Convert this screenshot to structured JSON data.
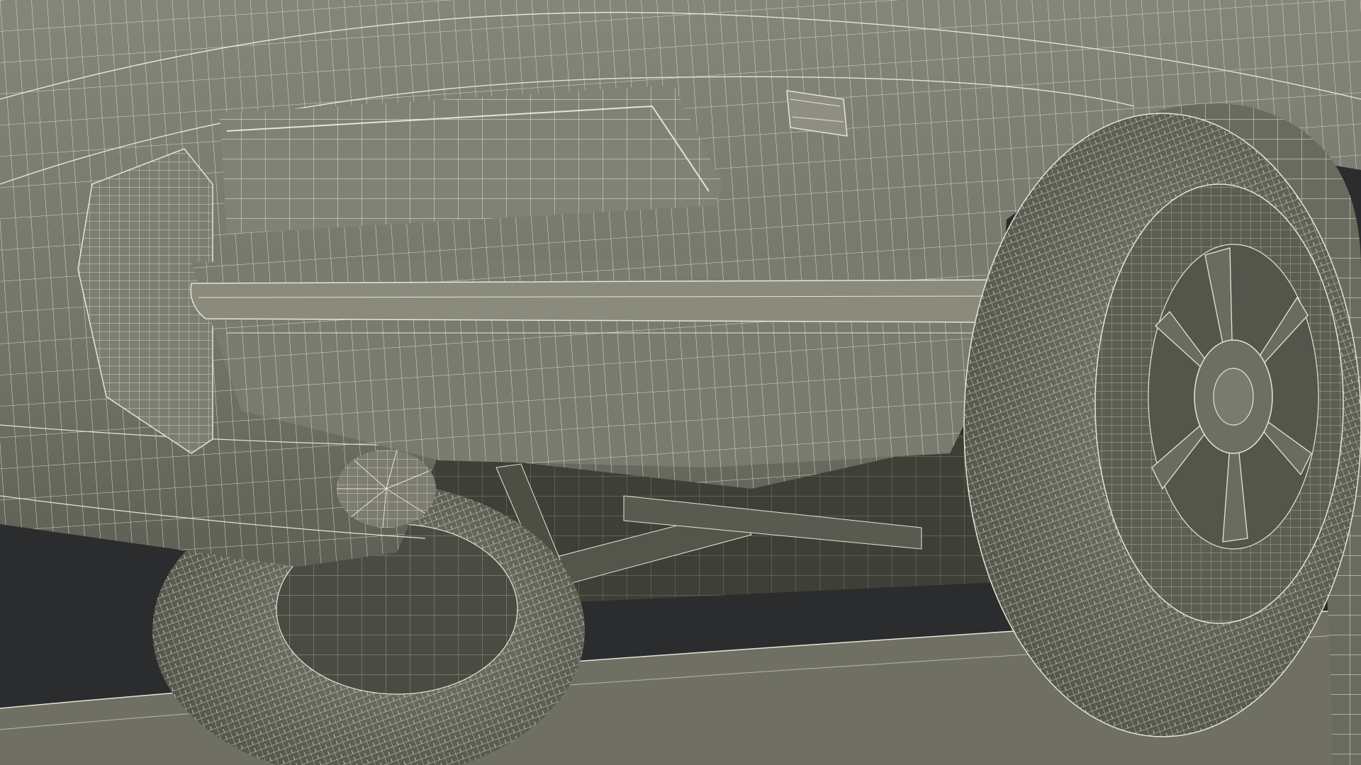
{
  "scene": {
    "subject": "wireframe-car-rear-underside",
    "colors": {
      "background": "#2b2c2d",
      "body_fill": "#76776a",
      "body_fill_light": "#8a8b7d",
      "body_fill_dark": "#55564b",
      "wire": "#e6e4d4",
      "underbody": "#3e3f37",
      "tire": "#65665a",
      "ground": "#6f7063"
    }
  }
}
